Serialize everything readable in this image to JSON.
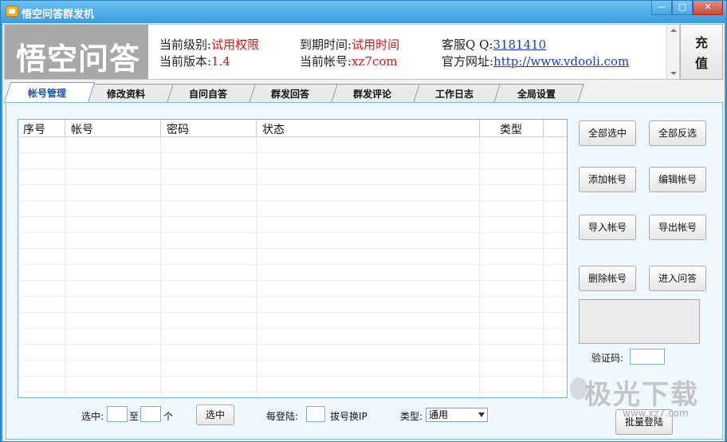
{
  "window": {
    "title": "悟空问答群发机",
    "min_glyph": "—",
    "max_glyph": "□",
    "close_glyph": "✕"
  },
  "header": {
    "logo": "悟空问答",
    "level_label": "当前级别:",
    "level_value": "试用权限",
    "version_label": "当前版本:",
    "version_value": "1.4",
    "expire_label": "到期时间:",
    "expire_value": "试用时间",
    "account_label": "当前帐号:",
    "account_value": "xz7com",
    "qq_label": "客服Q Q:",
    "qq_value": "3181410",
    "site_label": "官方网址:",
    "site_value": "http://www.vdooli.com",
    "recharge_line1": "充",
    "recharge_line2": "值"
  },
  "tabs": [
    {
      "label": "帐号管理",
      "active": true
    },
    {
      "label": "修改资料",
      "active": false
    },
    {
      "label": "自问自答",
      "active": false
    },
    {
      "label": "群发回答",
      "active": false
    },
    {
      "label": "群发评论",
      "active": false
    },
    {
      "label": "工作日志",
      "active": false
    },
    {
      "label": "全局设置",
      "active": false
    }
  ],
  "table": {
    "columns": [
      "序号",
      "帐号",
      "密码",
      "状态",
      "类型"
    ],
    "rows": []
  },
  "buttons": {
    "select_all": "全部选中",
    "invert_select": "全部反选",
    "add_account": "添加帐号",
    "edit_account": "编辑帐号",
    "import_account": "导入帐号",
    "export_account": "导出帐号",
    "delete_account": "删除帐号",
    "enter_qa": "进入问答",
    "batch_login": "批量登陆",
    "select": "选中"
  },
  "captcha": {
    "label": "验证码:",
    "value": ""
  },
  "footer": {
    "select_from_label": "选中:",
    "select_from_value": "",
    "to_label": "至",
    "select_to_value": "",
    "unit_label": "个",
    "per_login_label": "每登陆:",
    "per_login_value": "",
    "switch_ip_label": "拔号换IP",
    "type_label": "类型:",
    "type_value": "通用"
  },
  "watermark": {
    "main": "极光下载",
    "url": "www.xz7.com"
  }
}
